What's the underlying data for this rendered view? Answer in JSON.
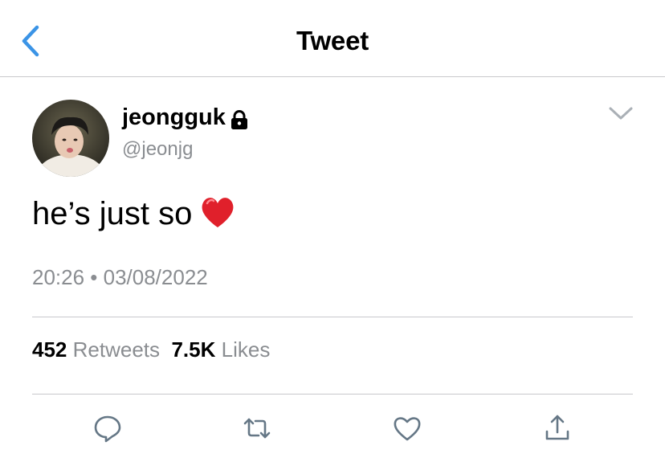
{
  "header": {
    "title": "Tweet"
  },
  "tweet": {
    "display_name": "jeongguk",
    "handle": "@jeonjg",
    "text": "he’s just so",
    "timestamp": "20:26 • 03/08/2022",
    "retweet_count": "452",
    "retweet_label": "Retweets",
    "like_count": "7.5K",
    "like_label": "Likes"
  },
  "icons": {
    "back": "chevron-left-icon",
    "lock": "lock-icon",
    "more": "chevron-down-icon",
    "emoji": "red-heart-emoji",
    "reply": "reply-icon",
    "retweet": "retweet-icon",
    "like": "heart-icon",
    "share": "share-icon"
  },
  "colors": {
    "accent": "#1da1f2",
    "icon_gray": "#657786",
    "secondary_text": "#8a8d91",
    "emoji_red": "#e0202b"
  }
}
